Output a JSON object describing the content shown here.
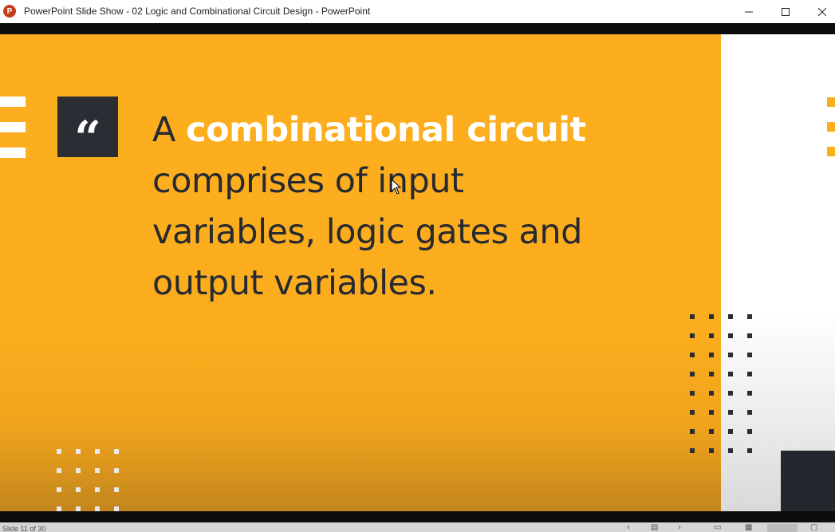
{
  "window": {
    "title": "PowerPoint Slide Show  -  02 Logic and Combinational Circuit Design - PowerPoint",
    "app_icon_letter": "P",
    "controls": {
      "minimize_icon": "minimize-icon",
      "maximize_icon": "maximize-icon",
      "close_icon": "close-icon"
    }
  },
  "slide": {
    "quote_mark": "“",
    "quote_lead": "A ",
    "quote_highlight": "combinational circuit",
    "quote_line2": "comprises of input",
    "quote_line3": "variables, logic gates and",
    "quote_line4": "output variables.",
    "colors": {
      "panel": "#fdae1f",
      "dark": "#2a2d33",
      "highlight_text": "#ffffff",
      "body_text": "#272a30"
    }
  },
  "statusbar": {
    "slide_counter": "Slide 11 of 30",
    "icons": [
      "previous-icon",
      "menu-icon",
      "next-icon",
      "normal-view-icon",
      "slide-sorter-icon",
      "reading-view-icon",
      "notes-icon"
    ]
  }
}
